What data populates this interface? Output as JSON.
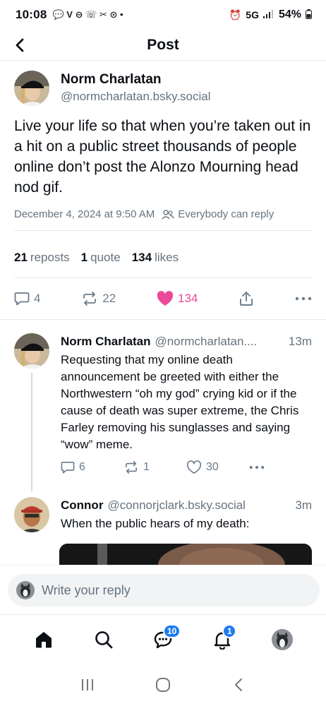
{
  "status_bar": {
    "time": "10:08",
    "left_icons": "💬 V ⊖ ☏ ✂ ⊙ •",
    "network": "5G",
    "battery": "54%"
  },
  "header": {
    "title": "Post"
  },
  "post": {
    "author_name": "Norm Charlatan",
    "author_handle": "@normcharlatan.bsky.social",
    "text": "Live your life so that when you’re taken out in a hit on a public street thousands of people online don’t post the Alonzo Mourning head nod gif.",
    "timestamp": "December 4, 2024 at 9:50 AM",
    "reply_setting": "Everybody can reply",
    "stats": {
      "reposts_count": "21",
      "reposts_label": "reposts",
      "quotes_count": "1",
      "quotes_label": "quote",
      "likes_count": "134",
      "likes_label": "likes"
    },
    "actions": {
      "replies": "4",
      "reposts": "22",
      "likes": "134"
    }
  },
  "replies": [
    {
      "author_name": "Norm Charlatan",
      "author_handle": "@normcharlatan....",
      "time": "13m",
      "text": "Requesting that my online death announcement be greeted with either the Northwestern “oh my god” crying kid or if the cause of death was super extreme, the Chris Farley removing his sunglasses and saying “wow” meme.",
      "replies": "6",
      "reposts": "1",
      "likes": "30"
    },
    {
      "author_name": "Connor",
      "author_handle": "@connorjclark.bsky.social",
      "time": "3m",
      "text": "When the public hears of my death:"
    }
  ],
  "composer": {
    "placeholder": "Write your reply"
  },
  "tabbar": {
    "messages_badge": "10",
    "notifications_badge": "1"
  },
  "colors": {
    "like": "#ec4899",
    "accent": "#1d7bf0",
    "muted": "#66737f"
  }
}
